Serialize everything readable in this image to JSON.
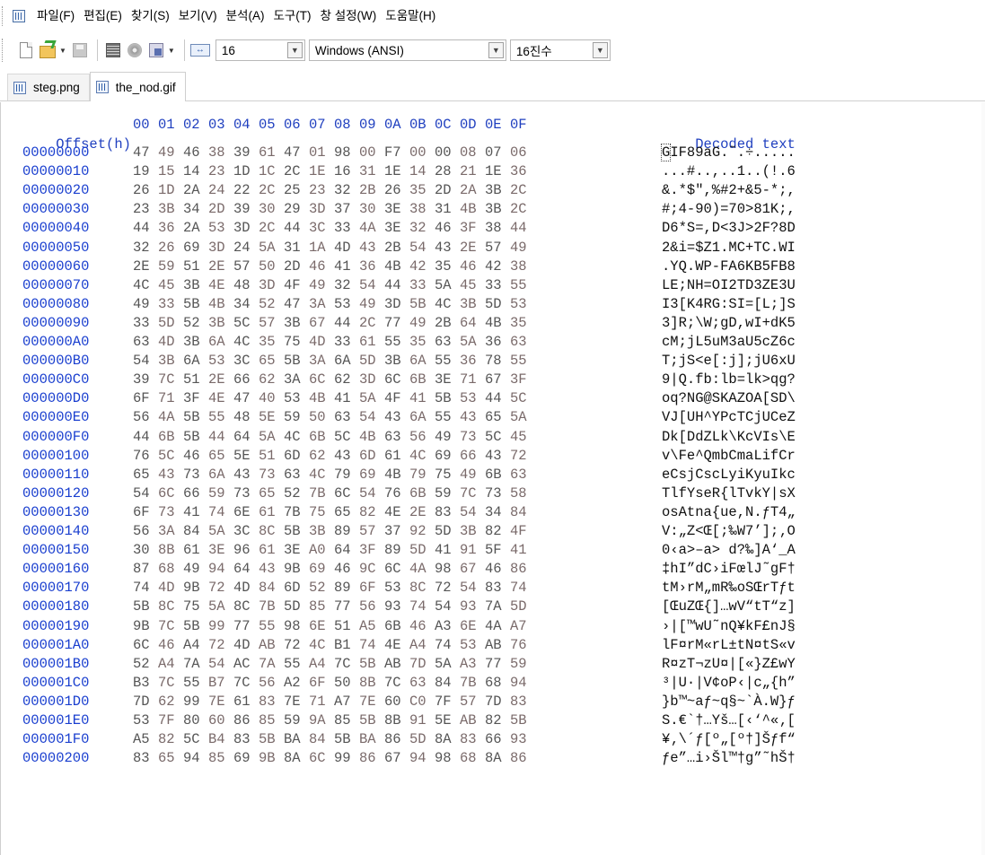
{
  "menu": {
    "items": [
      "파일(F)",
      "편집(E)",
      "찾기(S)",
      "보기(V)",
      "분석(A)",
      "도구(T)",
      "창 설정(W)",
      "도움말(H)"
    ]
  },
  "toolbar": {
    "bytes_per_row": "16",
    "encoding": "Windows (ANSI)",
    "offset_base": "16진수",
    "icons": [
      "new-file-icon",
      "open-folder-icon",
      "save-icon",
      "grid-icon",
      "disk-icon",
      "document-icon",
      "column-width-icon"
    ]
  },
  "tabs": [
    {
      "label": "steg.png",
      "active": false
    },
    {
      "label": "the_nod.gif",
      "active": true
    }
  ],
  "hex": {
    "offset_header": "Offset(h)",
    "column_headers": [
      "00",
      "01",
      "02",
      "03",
      "04",
      "05",
      "06",
      "07",
      "08",
      "09",
      "0A",
      "0B",
      "0C",
      "0D",
      "0E",
      "0F"
    ],
    "decoded_header": "Decoded text",
    "rows": [
      {
        "offset": "00000000",
        "bytes": "47 49 46 38 39 61 47 01 98 00 F7 00 00 08 07 06",
        "text": "GIF89aG.˜.÷....."
      },
      {
        "offset": "00000010",
        "bytes": "19 15 14 23 1D 1C 2C 1E 16 31 1E 14 28 21 1E 36",
        "text": "...#..,..1..(!.6"
      },
      {
        "offset": "00000020",
        "bytes": "26 1D 2A 24 22 2C 25 23 32 2B 26 35 2D 2A 3B 2C",
        "text": "&.*$\",%#2+&5-*;,"
      },
      {
        "offset": "00000030",
        "bytes": "23 3B 34 2D 39 30 29 3D 37 30 3E 38 31 4B 3B 2C",
        "text": "#;4-90)=70>81K;,"
      },
      {
        "offset": "00000040",
        "bytes": "44 36 2A 53 3D 2C 44 3C 33 4A 3E 32 46 3F 38 44",
        "text": "D6*S=,D<3J>2F?8D"
      },
      {
        "offset": "00000050",
        "bytes": "32 26 69 3D 24 5A 31 1A 4D 43 2B 54 43 2E 57 49",
        "text": "2&i=$Z1.MC+TC.WI"
      },
      {
        "offset": "00000060",
        "bytes": "2E 59 51 2E 57 50 2D 46 41 36 4B 42 35 46 42 38",
        "text": ".YQ.WP-FA6KB5FB8"
      },
      {
        "offset": "00000070",
        "bytes": "4C 45 3B 4E 48 3D 4F 49 32 54 44 33 5A 45 33 55",
        "text": "LE;NH=OI2TD3ZE3U"
      },
      {
        "offset": "00000080",
        "bytes": "49 33 5B 4B 34 52 47 3A 53 49 3D 5B 4C 3B 5D 53",
        "text": "I3[K4RG:SI=[L;]S"
      },
      {
        "offset": "00000090",
        "bytes": "33 5D 52 3B 5C 57 3B 67 44 2C 77 49 2B 64 4B 35",
        "text": "3]R;\\W;gD,wI+dK5"
      },
      {
        "offset": "000000A0",
        "bytes": "63 4D 3B 6A 4C 35 75 4D 33 61 55 35 63 5A 36 63",
        "text": "cM;jL5uM3aU5cZ6c"
      },
      {
        "offset": "000000B0",
        "bytes": "54 3B 6A 53 3C 65 5B 3A 6A 5D 3B 6A 55 36 78 55",
        "text": "T;jS<e[:j];jU6xU"
      },
      {
        "offset": "000000C0",
        "bytes": "39 7C 51 2E 66 62 3A 6C 62 3D 6C 6B 3E 71 67 3F",
        "text": "9|Q.fb:lb=lk>qg?"
      },
      {
        "offset": "000000D0",
        "bytes": "6F 71 3F 4E 47 40 53 4B 41 5A 4F 41 5B 53 44 5C",
        "text": "oq?NG@SKAZOA[SD\\"
      },
      {
        "offset": "000000E0",
        "bytes": "56 4A 5B 55 48 5E 59 50 63 54 43 6A 55 43 65 5A",
        "text": "VJ[UH^YPcTCjUCeZ"
      },
      {
        "offset": "000000F0",
        "bytes": "44 6B 5B 44 64 5A 4C 6B 5C 4B 63 56 49 73 5C 45",
        "text": "Dk[DdZLk\\KcVIs\\E"
      },
      {
        "offset": "00000100",
        "bytes": "76 5C 46 65 5E 51 6D 62 43 6D 61 4C 69 66 43 72",
        "text": "v\\Fe^QmbCmaLifCr"
      },
      {
        "offset": "00000110",
        "bytes": "65 43 73 6A 43 73 63 4C 79 69 4B 79 75 49 6B 63",
        "text": "eCsjCscLyiKyuIkc"
      },
      {
        "offset": "00000120",
        "bytes": "54 6C 66 59 73 65 52 7B 6C 54 76 6B 59 7C 73 58",
        "text": "TlfYseR{lTvkY|sX"
      },
      {
        "offset": "00000130",
        "bytes": "6F 73 41 74 6E 61 7B 75 65 82 4E 2E 83 54 34 84",
        "text": "osAtna{ue,N.ƒT4„"
      },
      {
        "offset": "00000140",
        "bytes": "56 3A 84 5A 3C 8C 5B 3B 89 57 37 92 5D 3B 82 4F",
        "text": "V:„Z<Œ[;‰W7’];‚O"
      },
      {
        "offset": "00000150",
        "bytes": "30 8B 61 3E 96 61 3E A0 64 3F 89 5D 41 91 5F 41",
        "text": "0‹a>–a> d?‰]A‘_A"
      },
      {
        "offset": "00000160",
        "bytes": "87 68 49 94 64 43 9B 69 46 9C 6C 4A 98 67 46 86",
        "text": "‡hI”dC›iFœlJ˜gF†"
      },
      {
        "offset": "00000170",
        "bytes": "74 4D 9B 72 4D 84 6D 52 89 6F 53 8C 72 54 83 74",
        "text": "tM›rM„mR‰oSŒrTƒt"
      },
      {
        "offset": "00000180",
        "bytes": "5B 8C 75 5A 8C 7B 5D 85 77 56 93 74 54 93 7A 5D",
        "text": "[ŒuZŒ{]…wV“tT“z]"
      },
      {
        "offset": "00000190",
        "bytes": "9B 7C 5B 99 77 55 98 6E 51 A5 6B 46 A3 6E 4A A7",
        "text": "›|[™wU˜nQ¥kF£nJ§"
      },
      {
        "offset": "000001A0",
        "bytes": "6C 46 A4 72 4D AB 72 4C B1 74 4E A4 74 53 AB 76",
        "text": "lF¤rM«rL±tN¤tS«v"
      },
      {
        "offset": "000001B0",
        "bytes": "52 A4 7A 54 AC 7A 55 A4 7C 5B AB 7D 5A A3 77 59",
        "text": "R¤zT¬zU¤|[«}Z£wY"
      },
      {
        "offset": "000001C0",
        "bytes": "B3 7C 55 B7 7C 56 A2 6F 50 8B 7C 63 84 7B 68 94",
        "text": "³|U·|V¢oP‹|c„{h”"
      },
      {
        "offset": "000001D0",
        "bytes": "7D 62 99 7E 61 83 7E 71 A7 7E 60 C0 7F 57 7D 83",
        "text": "}b™~aƒ~q§~`À.W}ƒ"
      },
      {
        "offset": "000001E0",
        "bytes": "53 7F 80 60 86 85 59 9A 85 5B 8B 91 5E AB 82 5B",
        "text": "S.€`†…Yš…[‹‘^«‚["
      },
      {
        "offset": "000001F0",
        "bytes": "A5 82 5C B4 83 5B BA 84 5B BA 86 5D 8A 83 66 93",
        "text": "¥‚\\´ƒ[º„[º†]Šƒf“"
      },
      {
        "offset": "00000200",
        "bytes": "83 65 94 85 69 9B 8A 6C 99 86 67 94 98 68 8A 86",
        "text": "ƒe”…i›Šl™†g”˜hŠ†"
      }
    ]
  }
}
